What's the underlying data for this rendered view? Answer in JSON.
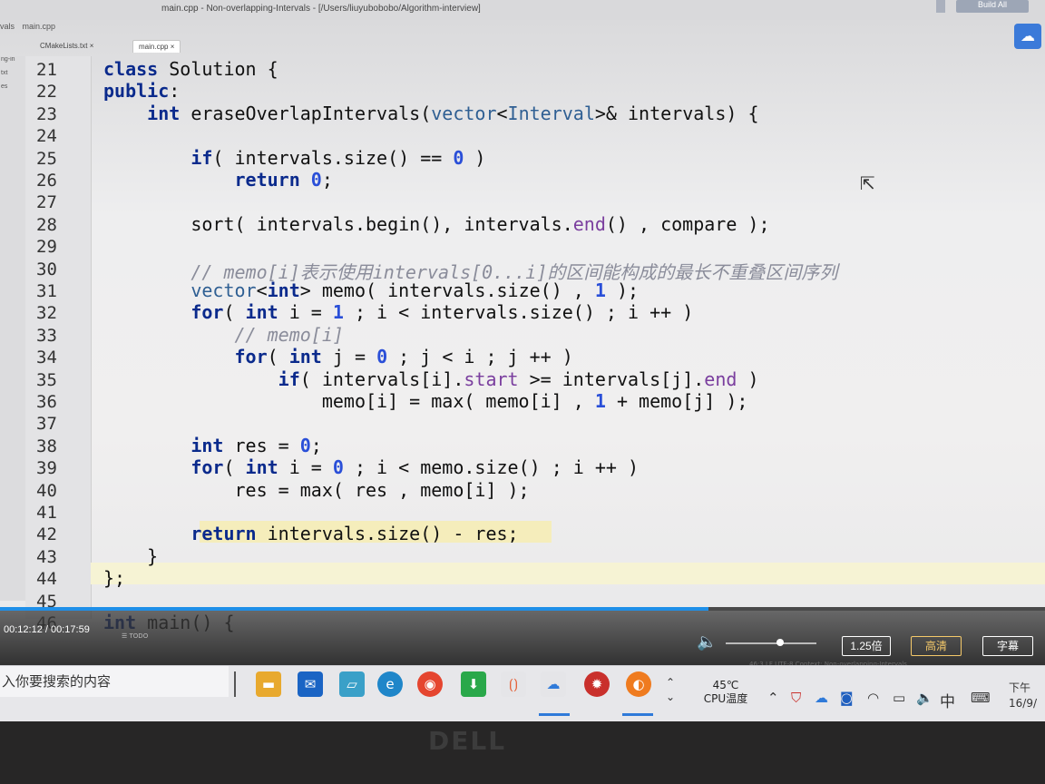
{
  "window": {
    "title": "main.cpp - Non-overlapping-Intervals - [/Users/liuyubobobo/Algorithm-interview]",
    "top_button": "Build All",
    "breadcrumb": [
      "vals",
      "main.cpp"
    ]
  },
  "tabs": [
    {
      "label": "CMakeLists.txt",
      "active": false
    },
    {
      "label": "main.cpp",
      "active": true
    }
  ],
  "sidebar_items": [
    "ng-in",
    "txt",
    "es"
  ],
  "gutter": {
    "line_numbers": [
      "21",
      "22",
      "23",
      "24",
      "25",
      "26",
      "27",
      "28",
      "29",
      "30",
      "31",
      "32",
      "33",
      "34",
      "35",
      "36",
      "37",
      "38",
      "39",
      "40",
      "41",
      "42",
      "43",
      "44",
      "45",
      "46"
    ]
  },
  "code_lines": [
    "class Solution {",
    "public:",
    "    int eraseOverlapIntervals(vector<Interval>& intervals) {",
    "",
    "        if( intervals.size() == 0 )",
    "            return 0;",
    "",
    "        sort( intervals.begin(), intervals.end() , compare );",
    "",
    "        // memo[i]表示使用intervals[0...i]的区间能构成的最长不重叠区间序列",
    "        vector<int> memo( intervals.size() , 1 );",
    "        for( int i = 1 ; i < intervals.size() ; i ++ )",
    "            // memo[i]",
    "            for( int j = 0 ; j < i ; j ++ )",
    "                if( intervals[i].start >= intervals[j].end )",
    "                    memo[i] = max( memo[i] , 1 + memo[j] );",
    "",
    "        int res = 0;",
    "        for( int i = 0 ; i < memo.size() ; i ++ )",
    "            res = max( res , memo[i] );",
    "",
    "        return intervals.size() - res;",
    "    }",
    "};",
    "",
    "int main() {"
  ],
  "player": {
    "time": "00:12:12 / 00:17:59",
    "progress": 0.678,
    "volume": 0.6,
    "speed_button": "1.25倍",
    "quality_button": "高清",
    "subtitle_button": "字幕"
  },
  "taskbar": {
    "search_placeholder": "入你要搜索的内容",
    "cpu_temp": "45℃",
    "cpu_label": "CPU温度",
    "ime": "中",
    "clock_time": "下午",
    "clock_date": "16/9/"
  },
  "status_bar": "46:3  LF  UTF-8  Context: Non-overlapping-Intervals",
  "todo_label": "TODO",
  "brand": "DELL"
}
